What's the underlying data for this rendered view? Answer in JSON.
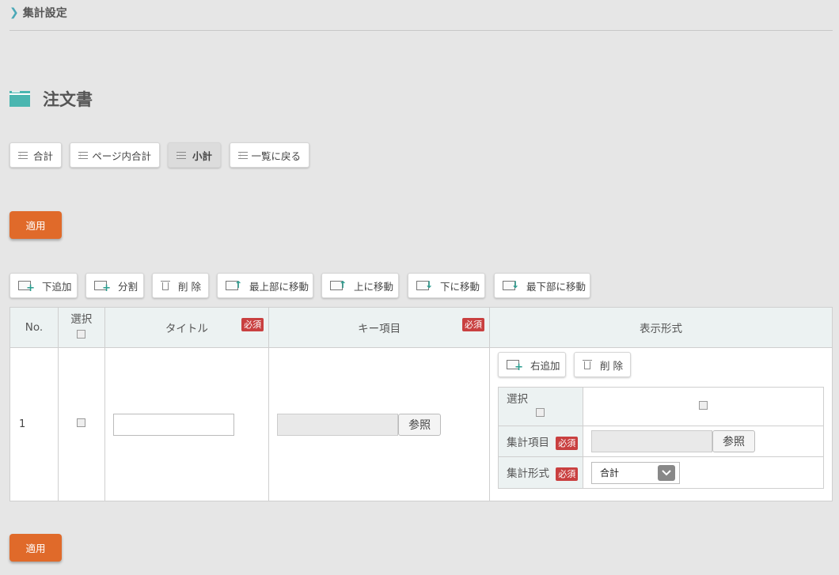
{
  "breadcrumb": {
    "label": "集計設定"
  },
  "page": {
    "title": "注文書"
  },
  "tabs": [
    {
      "label": "合計"
    },
    {
      "label": "ページ内合計"
    },
    {
      "label": "小計"
    },
    {
      "label": "一覧に戻る"
    }
  ],
  "apply_label": "適用",
  "toolbar": {
    "add_below": "下追加",
    "split": "分割",
    "delete": "削 除",
    "move_top": "最上部に移動",
    "move_up": "上に移動",
    "move_down": "下に移動",
    "move_bottom": "最下部に移動"
  },
  "table": {
    "headers": {
      "no": "No.",
      "select": "選択",
      "title": "タイトル",
      "key": "キー項目",
      "display": "表示形式"
    },
    "required": "必須",
    "rows": [
      {
        "no": "1"
      }
    ],
    "ref_label": "参照",
    "display": {
      "add_right": "右追加",
      "delete": "削 除",
      "select_label": "選択",
      "agg_item_label": "集計項目",
      "agg_format_label": "集計形式",
      "agg_format_value": "合計"
    }
  },
  "colors": {
    "accent": "#4ab6b0",
    "apply": "#e06a2a",
    "required": "#c94040"
  }
}
